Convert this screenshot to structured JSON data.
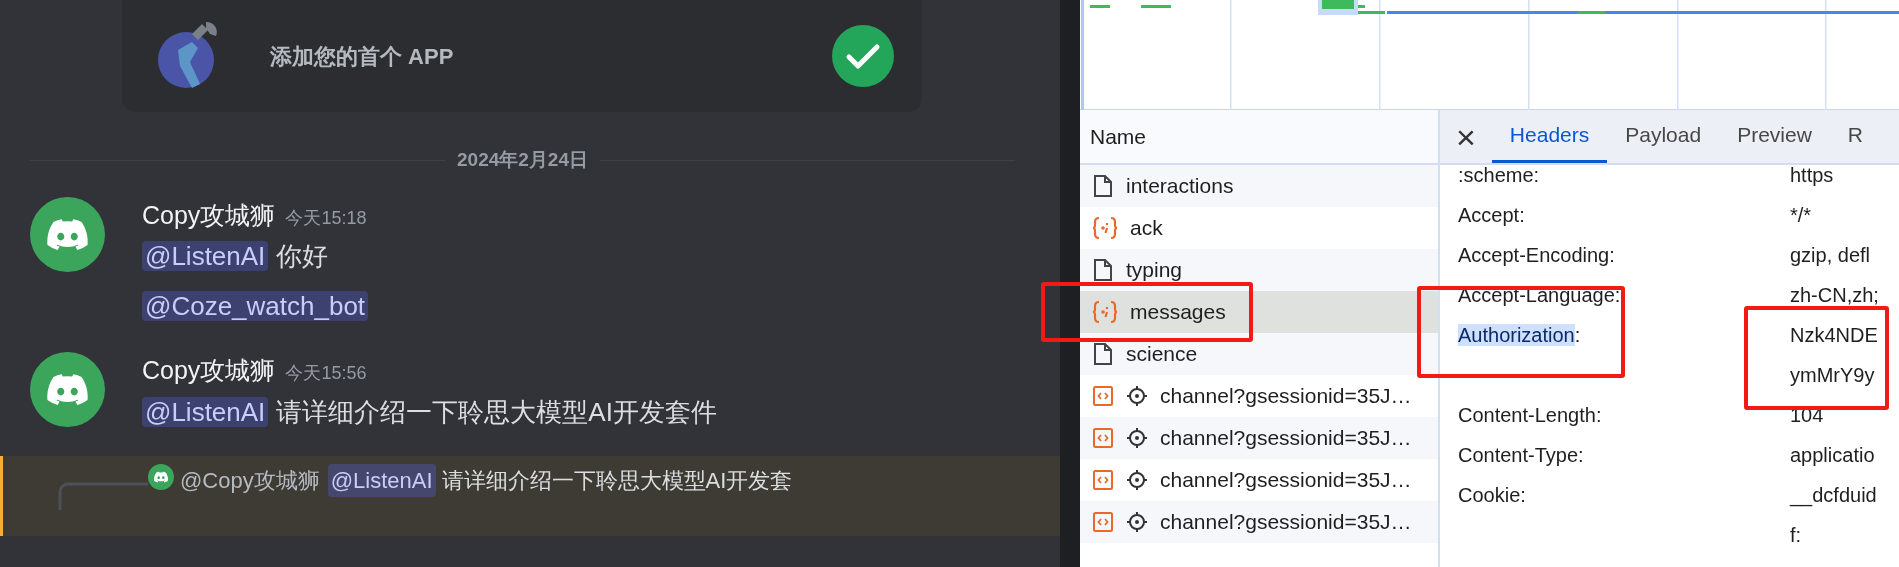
{
  "chat": {
    "app_card": {
      "title": "添加您的首个 APP",
      "completed": true
    },
    "date_divider": "2024年2月24日",
    "messages": [
      {
        "author": "Copy攻城狮",
        "time": "今天15:18",
        "lines": [
          {
            "mention": "@ListenAI",
            "text": "你好"
          },
          {
            "mention": "@Coze_watch_bot"
          }
        ]
      },
      {
        "author": "Copy攻城狮",
        "time": "今天15:56",
        "lines": [
          {
            "mention": "@ListenAI",
            "text": "请详细介绍一下聆思大模型AI开发套件"
          }
        ]
      }
    ],
    "reply": {
      "author": "@Copy攻城狮",
      "mention": "@ListenAI",
      "text": "请详细介绍一下聆思大模型AI开发套"
    }
  },
  "devtools": {
    "requests_header": "Name",
    "requests": [
      {
        "name": "interactions",
        "kind": "document",
        "selected": false,
        "annotated": false
      },
      {
        "name": "ack",
        "kind": "fetch",
        "selected": false,
        "annotated": false
      },
      {
        "name": "typing",
        "kind": "document",
        "selected": false,
        "annotated": false
      },
      {
        "name": "messages",
        "kind": "fetch",
        "selected": true,
        "annotated": true
      },
      {
        "name": "science",
        "kind": "document",
        "selected": false,
        "annotated": false
      },
      {
        "name": "channel?gsessionid=35J…",
        "kind": "script",
        "selected": false,
        "annotated": false
      },
      {
        "name": "channel?gsessionid=35J…",
        "kind": "script",
        "selected": false,
        "annotated": false
      },
      {
        "name": "channel?gsessionid=35J…",
        "kind": "script",
        "selected": false,
        "annotated": false
      },
      {
        "name": "channel?gsessionid=35J…",
        "kind": "script",
        "selected": false,
        "annotated": false
      }
    ],
    "close_label": "×",
    "tabs": [
      {
        "label": "Headers",
        "selected": true
      },
      {
        "label": "Payload",
        "selected": false
      },
      {
        "label": "Preview",
        "selected": false
      },
      {
        "label": "R",
        "selected": false
      }
    ],
    "headers": [
      {
        "name": ":scheme:",
        "values": [
          "https"
        ],
        "highlighted": false,
        "annotated": false
      },
      {
        "name": "Accept:",
        "values": [
          "*/*"
        ],
        "highlighted": false,
        "annotated": false
      },
      {
        "name": "Accept-Encoding:",
        "values": [
          "gzip, defl"
        ],
        "highlighted": false,
        "annotated": false
      },
      {
        "name": "Accept-Language:",
        "values": [
          "zh-CN,zh;"
        ],
        "highlighted": false,
        "annotated": false
      },
      {
        "name": "Authorization",
        "suffix": ":",
        "values": [
          "Nzk4NDE",
          "ymMrY9y"
        ],
        "highlighted": true,
        "annotated": true
      },
      {
        "name": "Content-Length:",
        "values": [
          "104"
        ],
        "highlighted": false,
        "annotated": false
      },
      {
        "name": "Content-Type:",
        "values": [
          "applicatio"
        ],
        "highlighted": false,
        "annotated": false
      },
      {
        "name": "Cookie:",
        "values": [
          "__dcfduid",
          "f:"
        ],
        "highlighted": false,
        "annotated": false
      }
    ]
  }
}
